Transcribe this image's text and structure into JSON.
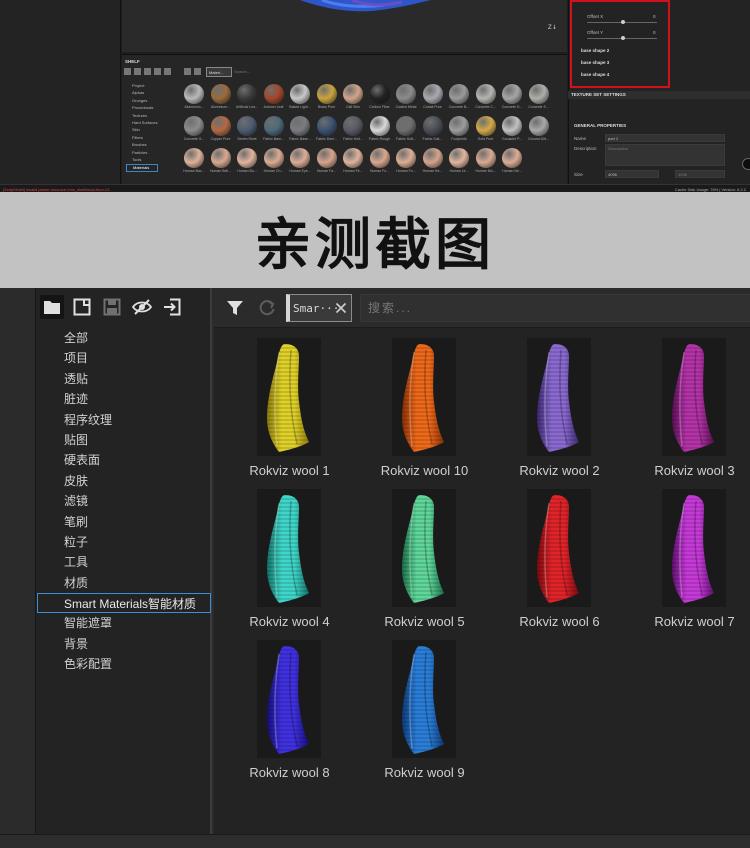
{
  "top_screenshot": {
    "axis_label": "z↓",
    "shelf_title": "SHELF",
    "shelf_tab": "Materi...",
    "shelf_search": "Search...",
    "categories": [
      "Project",
      "Alphas",
      "Grunges",
      "Procedurals",
      "Textures",
      "Hard Surfaces",
      "Skin",
      "Filters",
      "Brushes",
      "Particles",
      "Tools",
      "Materials"
    ],
    "selected_category": "Materials",
    "materials": [
      {
        "label": "Aluminium...",
        "color": "#b9b9bd"
      },
      {
        "label": "Aluminium...",
        "color": "#9a6b3c"
      },
      {
        "label": "Artificial Lea...",
        "color": "#3a3a3a"
      },
      {
        "label": "Autumn Leaf",
        "color": "#a2472a"
      },
      {
        "label": "Baked Light...",
        "color": "#c8c8c8"
      },
      {
        "label": "Brass Pure",
        "color": "#c9a53e"
      },
      {
        "label": "Calf Skin",
        "color": "#d1a48a"
      },
      {
        "label": "Carbon Fiber",
        "color": "#222222"
      },
      {
        "label": "Coated Metal",
        "color": "#8b8b8e"
      },
      {
        "label": "Cobalt Pure",
        "color": "#a9aab0"
      },
      {
        "label": "Concrete B...",
        "color": "#9a9a98"
      },
      {
        "label": "Concrete C...",
        "color": "#b5b5b2"
      },
      {
        "label": "Concrete D...",
        "color": "#a6a6a3"
      },
      {
        "label": "Concrete S...",
        "color": "#b0aea9"
      },
      {
        "label": "Concrete S...",
        "color": "#8c8c8a"
      },
      {
        "label": "Copper Pure",
        "color": "#b26a43"
      },
      {
        "label": "Denim Rivet",
        "color": "#4d5b72"
      },
      {
        "label": "Fabric Bam...",
        "color": "#4b6a7a"
      },
      {
        "label": "Fabric Base...",
        "color": "#7a7d80"
      },
      {
        "label": "Fabric Deni...",
        "color": "#3a5270"
      },
      {
        "label": "Fabric Knit...",
        "color": "#575b62"
      },
      {
        "label": "Fabric Rough",
        "color": "#d9d9d9"
      },
      {
        "label": "Fabric Soft...",
        "color": "#6e6e6e"
      },
      {
        "label": "Fabric Suit...",
        "color": "#4a4f55"
      },
      {
        "label": "Footprints",
        "color": "#9d9d9d"
      },
      {
        "label": "Gold Pure",
        "color": "#d4a94a"
      },
      {
        "label": "Gouache P...",
        "color": "#c2c2c2"
      },
      {
        "label": "Ground Dirt...",
        "color": "#a8a8a8"
      },
      {
        "label": "Human Bac...",
        "color": "#deb29a"
      },
      {
        "label": "Human Bell...",
        "color": "#d8a891"
      },
      {
        "label": "Human Bu...",
        "color": "#e0b49d"
      },
      {
        "label": "Human Ch...",
        "color": "#d9ab93"
      },
      {
        "label": "Human Eye...",
        "color": "#dcae96"
      },
      {
        "label": "Human Fa...",
        "color": "#d6a58c"
      },
      {
        "label": "Human Fe...",
        "color": "#dfb39b"
      },
      {
        "label": "Human Fo...",
        "color": "#d8a88f"
      },
      {
        "label": "Human Fo...",
        "color": "#dcae95"
      },
      {
        "label": "Human He...",
        "color": "#d5a58c"
      },
      {
        "label": "Human Le...",
        "color": "#e1b59e"
      },
      {
        "label": "Human Mo...",
        "color": "#d9aa92"
      },
      {
        "label": "Human Ne...",
        "color": "#dbad94"
      }
    ],
    "props": {
      "offset_x_label": "Offset X",
      "offset_x_value": "0",
      "offset_y_label": "Offset Y",
      "offset_y_value": "0",
      "base_shape_2": "base shape 2",
      "base_shape_3": "base shape 3",
      "base_shape_4": "base shape 4"
    },
    "texture_set_settings": {
      "title": "TEXTURE SET SETTINGS",
      "general_properties": "GENERAL PROPERTIES",
      "name_label": "Name",
      "name_value": "part 2",
      "description_label": "Description",
      "description_placeholder": "Description",
      "size_label": "Size",
      "size_value": "4096",
      "size_value_2": "4096"
    },
    "status_error": "[Scrip/Hotel] invalid preset resource://mx_shelf/wool-floor-01",
    "status_right": "Cache Disk Usage:  76% | Version: 6.2.2"
  },
  "banner": {
    "title": "亲测截图"
  },
  "shelf": {
    "categories": [
      "全部",
      "项目",
      "透贴",
      "脏迹",
      "程序纹理",
      "贴图",
      "硬表面",
      "皮肤",
      "滤镜",
      "笔刷",
      "粒子",
      "工具",
      "材质",
      "Smart Materials智能材质",
      "智能遮罩",
      "背景",
      "色彩配置"
    ],
    "selected_index": 13,
    "filter_chip": "Smar···",
    "search_placeholder": "搜索...",
    "search_value": "",
    "items": [
      {
        "label": "Rokviz wool 1",
        "color": "#e0d12a",
        "dark": "#8a7a0c"
      },
      {
        "label": "Rokviz wool 10",
        "color": "#ee6a1a",
        "dark": "#8a2f06"
      },
      {
        "label": "Rokviz wool 2",
        "color": "#8a6ad0",
        "dark": "#3b2870"
      },
      {
        "label": "Rokviz wool 3",
        "color": "#b533a8",
        "dark": "#5a0f55"
      },
      {
        "label": "Rokviz wool 4",
        "color": "#3fd6c9",
        "dark": "#137068"
      },
      {
        "label": "Rokviz wool 5",
        "color": "#5fd69a",
        "dark": "#1c7048"
      },
      {
        "label": "Rokviz wool 6",
        "color": "#e0242a",
        "dark": "#7a0a0e"
      },
      {
        "label": "Rokviz wool 7",
        "color": "#c63ad8",
        "dark": "#5e1070"
      },
      {
        "label": "Rokviz wool 8",
        "color": "#4030e0",
        "dark": "#150e7a"
      },
      {
        "label": "Rokviz wool 9",
        "color": "#2a7ed8",
        "dark": "#0d3a78"
      }
    ]
  }
}
